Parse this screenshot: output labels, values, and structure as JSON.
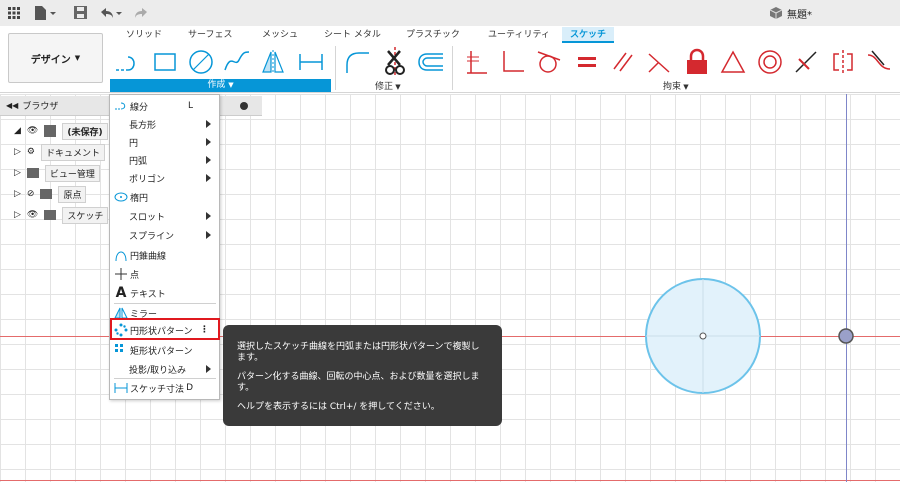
{
  "titlebar": {
    "doc_title": "無題*"
  },
  "ribbon": {
    "workspace_label": "デザイン",
    "tabs": [
      "ソリッド",
      "サーフェス",
      "メッシュ",
      "シート メタル",
      "プラスチック",
      "ユーティリティ",
      "スケッチ"
    ],
    "active_tab_index": 6,
    "group_create": "作成",
    "group_modify": "修正",
    "group_constraints": "拘束"
  },
  "browser": {
    "title": "ブラウザ",
    "items": [
      "(未保存)",
      "ドキュメント",
      "ビュー管理",
      "原点",
      "スケッチ"
    ]
  },
  "menu": {
    "items": [
      {
        "label": "線分",
        "shortcut": "L",
        "submenu": false,
        "icon": "line-icon"
      },
      {
        "label": "長方形",
        "submenu": true,
        "icon": ""
      },
      {
        "label": "円",
        "submenu": true,
        "icon": ""
      },
      {
        "label": "円弧",
        "submenu": true,
        "icon": ""
      },
      {
        "label": "ポリゴン",
        "submenu": true,
        "icon": ""
      },
      {
        "label": "楕円",
        "submenu": false,
        "icon": "ellipse-icon"
      },
      {
        "label": "スロット",
        "submenu": true,
        "icon": ""
      },
      {
        "label": "スプライン",
        "submenu": true,
        "icon": ""
      },
      {
        "label": "円錐曲線",
        "submenu": false,
        "icon": "conic-icon"
      },
      {
        "label": "点",
        "submenu": false,
        "icon": "point-icon"
      },
      {
        "label": "テキスト",
        "submenu": false,
        "icon": "text-icon"
      },
      {
        "label": "ミラー",
        "submenu": false,
        "icon": "mirror-icon"
      },
      {
        "label": "円形状パターン",
        "submenu": false,
        "icon": "circular-pattern-icon"
      },
      {
        "label": "矩形状パターン",
        "submenu": false,
        "icon": "rectangular-pattern-icon"
      },
      {
        "label": "投影/取り込み",
        "submenu": true,
        "icon": ""
      },
      {
        "label": "スケッチ寸法",
        "shortcut": "D",
        "submenu": false,
        "icon": "dimension-icon"
      }
    ]
  },
  "tooltip": {
    "line1": "選択したスケッチ曲線を円弧または円形状パターンで複製します。",
    "line2": "パターン化する曲線、回転の中心点、および数量を選択します。",
    "line3": "ヘルプを表示するには Ctrl+/ を押してください。"
  },
  "colors": {
    "accent": "#0696d7",
    "constraint_red": "#d4292f",
    "x_axis": "#e46b6b",
    "y_axis": "#7f86c9",
    "circle_fill": "#e2f2fb",
    "circle_stroke": "#6cc3ea"
  }
}
